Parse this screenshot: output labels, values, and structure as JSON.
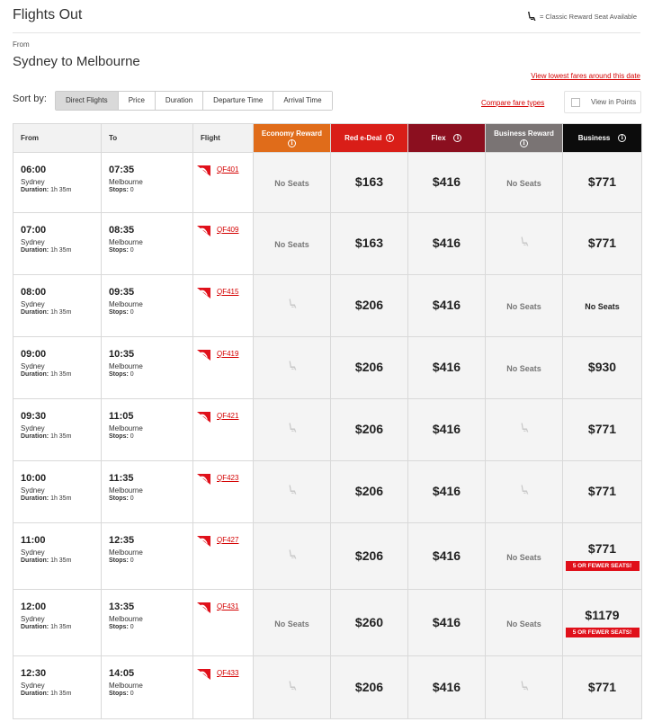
{
  "header": {
    "title": "Flights Out",
    "legend_text": "= Classic Reward Seat Available"
  },
  "search": {
    "from_label": "From",
    "route": "Sydney to Melbourne",
    "lowest_fares_link": "View lowest fares around this date",
    "compare_link": "Compare fare types",
    "view_in_points": "View in Points"
  },
  "sort": {
    "label": "Sort by:",
    "tabs": [
      "Direct Flights",
      "Price",
      "Duration",
      "Departure Time",
      "Arrival Time"
    ],
    "active": "Direct Flights"
  },
  "table": {
    "headers": {
      "from": "From",
      "to": "To",
      "flight": "Flight",
      "economy_reward": "Economy Reward",
      "red_e_deal": "Red e-Deal",
      "flex": "Flex",
      "business_reward": "Business Reward",
      "business": "Business"
    },
    "duration_label": "Duration:",
    "stops_label": "Stops:",
    "colors": {
      "economy_reward": "#e06c1a",
      "red_e_deal": "#d91e18",
      "flex": "#8b0f1f",
      "business_reward": "#7a7474",
      "business": "#0c0c0c",
      "link": "#d40000"
    },
    "rows": [
      {
        "dep": "06:00",
        "arr": "07:35",
        "from_city": "Sydney",
        "to_city": "Melbourne",
        "duration": "1h 35m",
        "stops": "0",
        "flight": "QF401",
        "economy_reward": "No Seats",
        "red_e_deal": "$163",
        "flex": "$416",
        "business_reward": "No Seats",
        "business": "$771",
        "badge": ""
      },
      {
        "dep": "07:00",
        "arr": "08:35",
        "from_city": "Sydney",
        "to_city": "Melbourne",
        "duration": "1h 35m",
        "stops": "0",
        "flight": "QF409",
        "economy_reward": "No Seats",
        "red_e_deal": "$163",
        "flex": "$416",
        "business_reward": "seat-icon",
        "business": "$771",
        "badge": ""
      },
      {
        "dep": "08:00",
        "arr": "09:35",
        "from_city": "Sydney",
        "to_city": "Melbourne",
        "duration": "1h 35m",
        "stops": "0",
        "flight": "QF415",
        "economy_reward": "seat-icon",
        "red_e_deal": "$206",
        "flex": "$416",
        "business_reward": "No Seats",
        "business": "No Seats",
        "badge": ""
      },
      {
        "dep": "09:00",
        "arr": "10:35",
        "from_city": "Sydney",
        "to_city": "Melbourne",
        "duration": "1h 35m",
        "stops": "0",
        "flight": "QF419",
        "economy_reward": "seat-icon",
        "red_e_deal": "$206",
        "flex": "$416",
        "business_reward": "No Seats",
        "business": "$930",
        "badge": ""
      },
      {
        "dep": "09:30",
        "arr": "11:05",
        "from_city": "Sydney",
        "to_city": "Melbourne",
        "duration": "1h 35m",
        "stops": "0",
        "flight": "QF421",
        "economy_reward": "seat-icon",
        "red_e_deal": "$206",
        "flex": "$416",
        "business_reward": "seat-icon",
        "business": "$771",
        "badge": ""
      },
      {
        "dep": "10:00",
        "arr": "11:35",
        "from_city": "Sydney",
        "to_city": "Melbourne",
        "duration": "1h 35m",
        "stops": "0",
        "flight": "QF423",
        "economy_reward": "seat-icon",
        "red_e_deal": "$206",
        "flex": "$416",
        "business_reward": "seat-icon",
        "business": "$771",
        "badge": ""
      },
      {
        "dep": "11:00",
        "arr": "12:35",
        "from_city": "Sydney",
        "to_city": "Melbourne",
        "duration": "1h 35m",
        "stops": "0",
        "flight": "QF427",
        "economy_reward": "seat-icon",
        "red_e_deal": "$206",
        "flex": "$416",
        "business_reward": "No Seats",
        "business": "$771",
        "badge": "5 OR FEWER SEATS!"
      },
      {
        "dep": "12:00",
        "arr": "13:35",
        "from_city": "Sydney",
        "to_city": "Melbourne",
        "duration": "1h 35m",
        "stops": "0",
        "flight": "QF431",
        "economy_reward": "No Seats",
        "red_e_deal": "$260",
        "flex": "$416",
        "business_reward": "No Seats",
        "business": "$1179",
        "badge": "5 OR FEWER SEATS!"
      },
      {
        "dep": "12:30",
        "arr": "14:05",
        "from_city": "Sydney",
        "to_city": "Melbourne",
        "duration": "1h 35m",
        "stops": "0",
        "flight": "QF433",
        "economy_reward": "seat-icon",
        "red_e_deal": "$206",
        "flex": "$416",
        "business_reward": "seat-icon",
        "business": "$771",
        "badge": ""
      }
    ]
  }
}
